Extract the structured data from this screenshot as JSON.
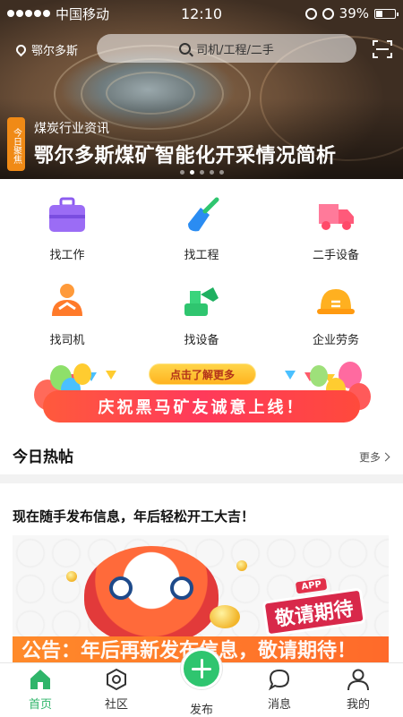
{
  "status_bar": {
    "carrier": "中国移动",
    "time": "12:10",
    "battery": "39%",
    "battery_level": 0.39
  },
  "topbar": {
    "location": "鄂尔多斯",
    "search_placeholder": "司机/工程/二手",
    "search_icon": "search-icon",
    "scan_icon": "scan-icon"
  },
  "hero": {
    "tag": "今日聚焦",
    "subtitle": "煤炭行业资讯",
    "title": "鄂尔多斯煤矿智能化开采情况简析"
  },
  "grid": {
    "items": [
      {
        "label": "找工作",
        "icon": "briefcase-icon",
        "color": "#8c5cf0"
      },
      {
        "label": "找工程",
        "icon": "shovel-icon",
        "color": "#2a8cf2"
      },
      {
        "label": "二手设备",
        "icon": "truck-icon",
        "color": "#ff6a8a"
      },
      {
        "label": "找司机",
        "icon": "driver-icon",
        "color": "#ff8a2a"
      },
      {
        "label": "找设备",
        "icon": "excavator-icon",
        "color": "#2fc56f"
      },
      {
        "label": "企业劳务",
        "icon": "hardhat-icon",
        "color": "#ffb020"
      }
    ]
  },
  "promo": {
    "pill": "点击了解更多",
    "headline": "庆祝黑马矿友诚意上线！"
  },
  "hot_posts": {
    "title": "今日热帖",
    "more": "更多",
    "post_title": "现在随手发布信息，年后轻松开工大吉！",
    "image_notice": "公告：年后再新发布信息，敬请期待！",
    "badge_label": "APP",
    "badge_text": "敬请期待"
  },
  "tabbar": {
    "items": [
      {
        "label": "首页",
        "icon": "home-icon"
      },
      {
        "label": "社区",
        "icon": "community-icon"
      },
      {
        "label": "发布",
        "icon": "plus-icon"
      },
      {
        "label": "消息",
        "icon": "message-icon"
      },
      {
        "label": "我的",
        "icon": "user-icon"
      }
    ],
    "active_color": "#2fb56a"
  }
}
